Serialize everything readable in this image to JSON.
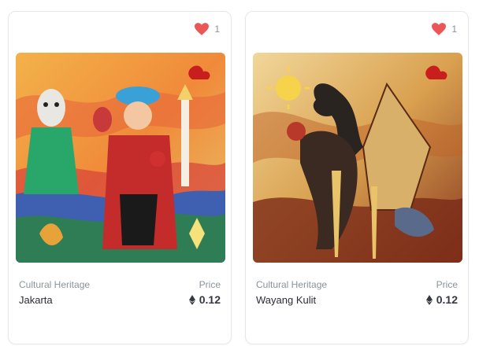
{
  "cards": [
    {
      "likes": "1",
      "collection": "Cultural Heritage",
      "price_label": "Price",
      "name": "Jakarta",
      "price": "0.12",
      "icon_heart": "heart-icon",
      "icon_currency": "ethereum-icon"
    },
    {
      "likes": "1",
      "collection": "Cultural Heritage",
      "price_label": "Price",
      "name": "Wayang Kulit",
      "price": "0.12",
      "icon_heart": "heart-icon",
      "icon_currency": "ethereum-icon"
    }
  ],
  "colors": {
    "heart": "#eb5757",
    "muted_text": "#8a939b",
    "border": "#e5e8eb"
  }
}
